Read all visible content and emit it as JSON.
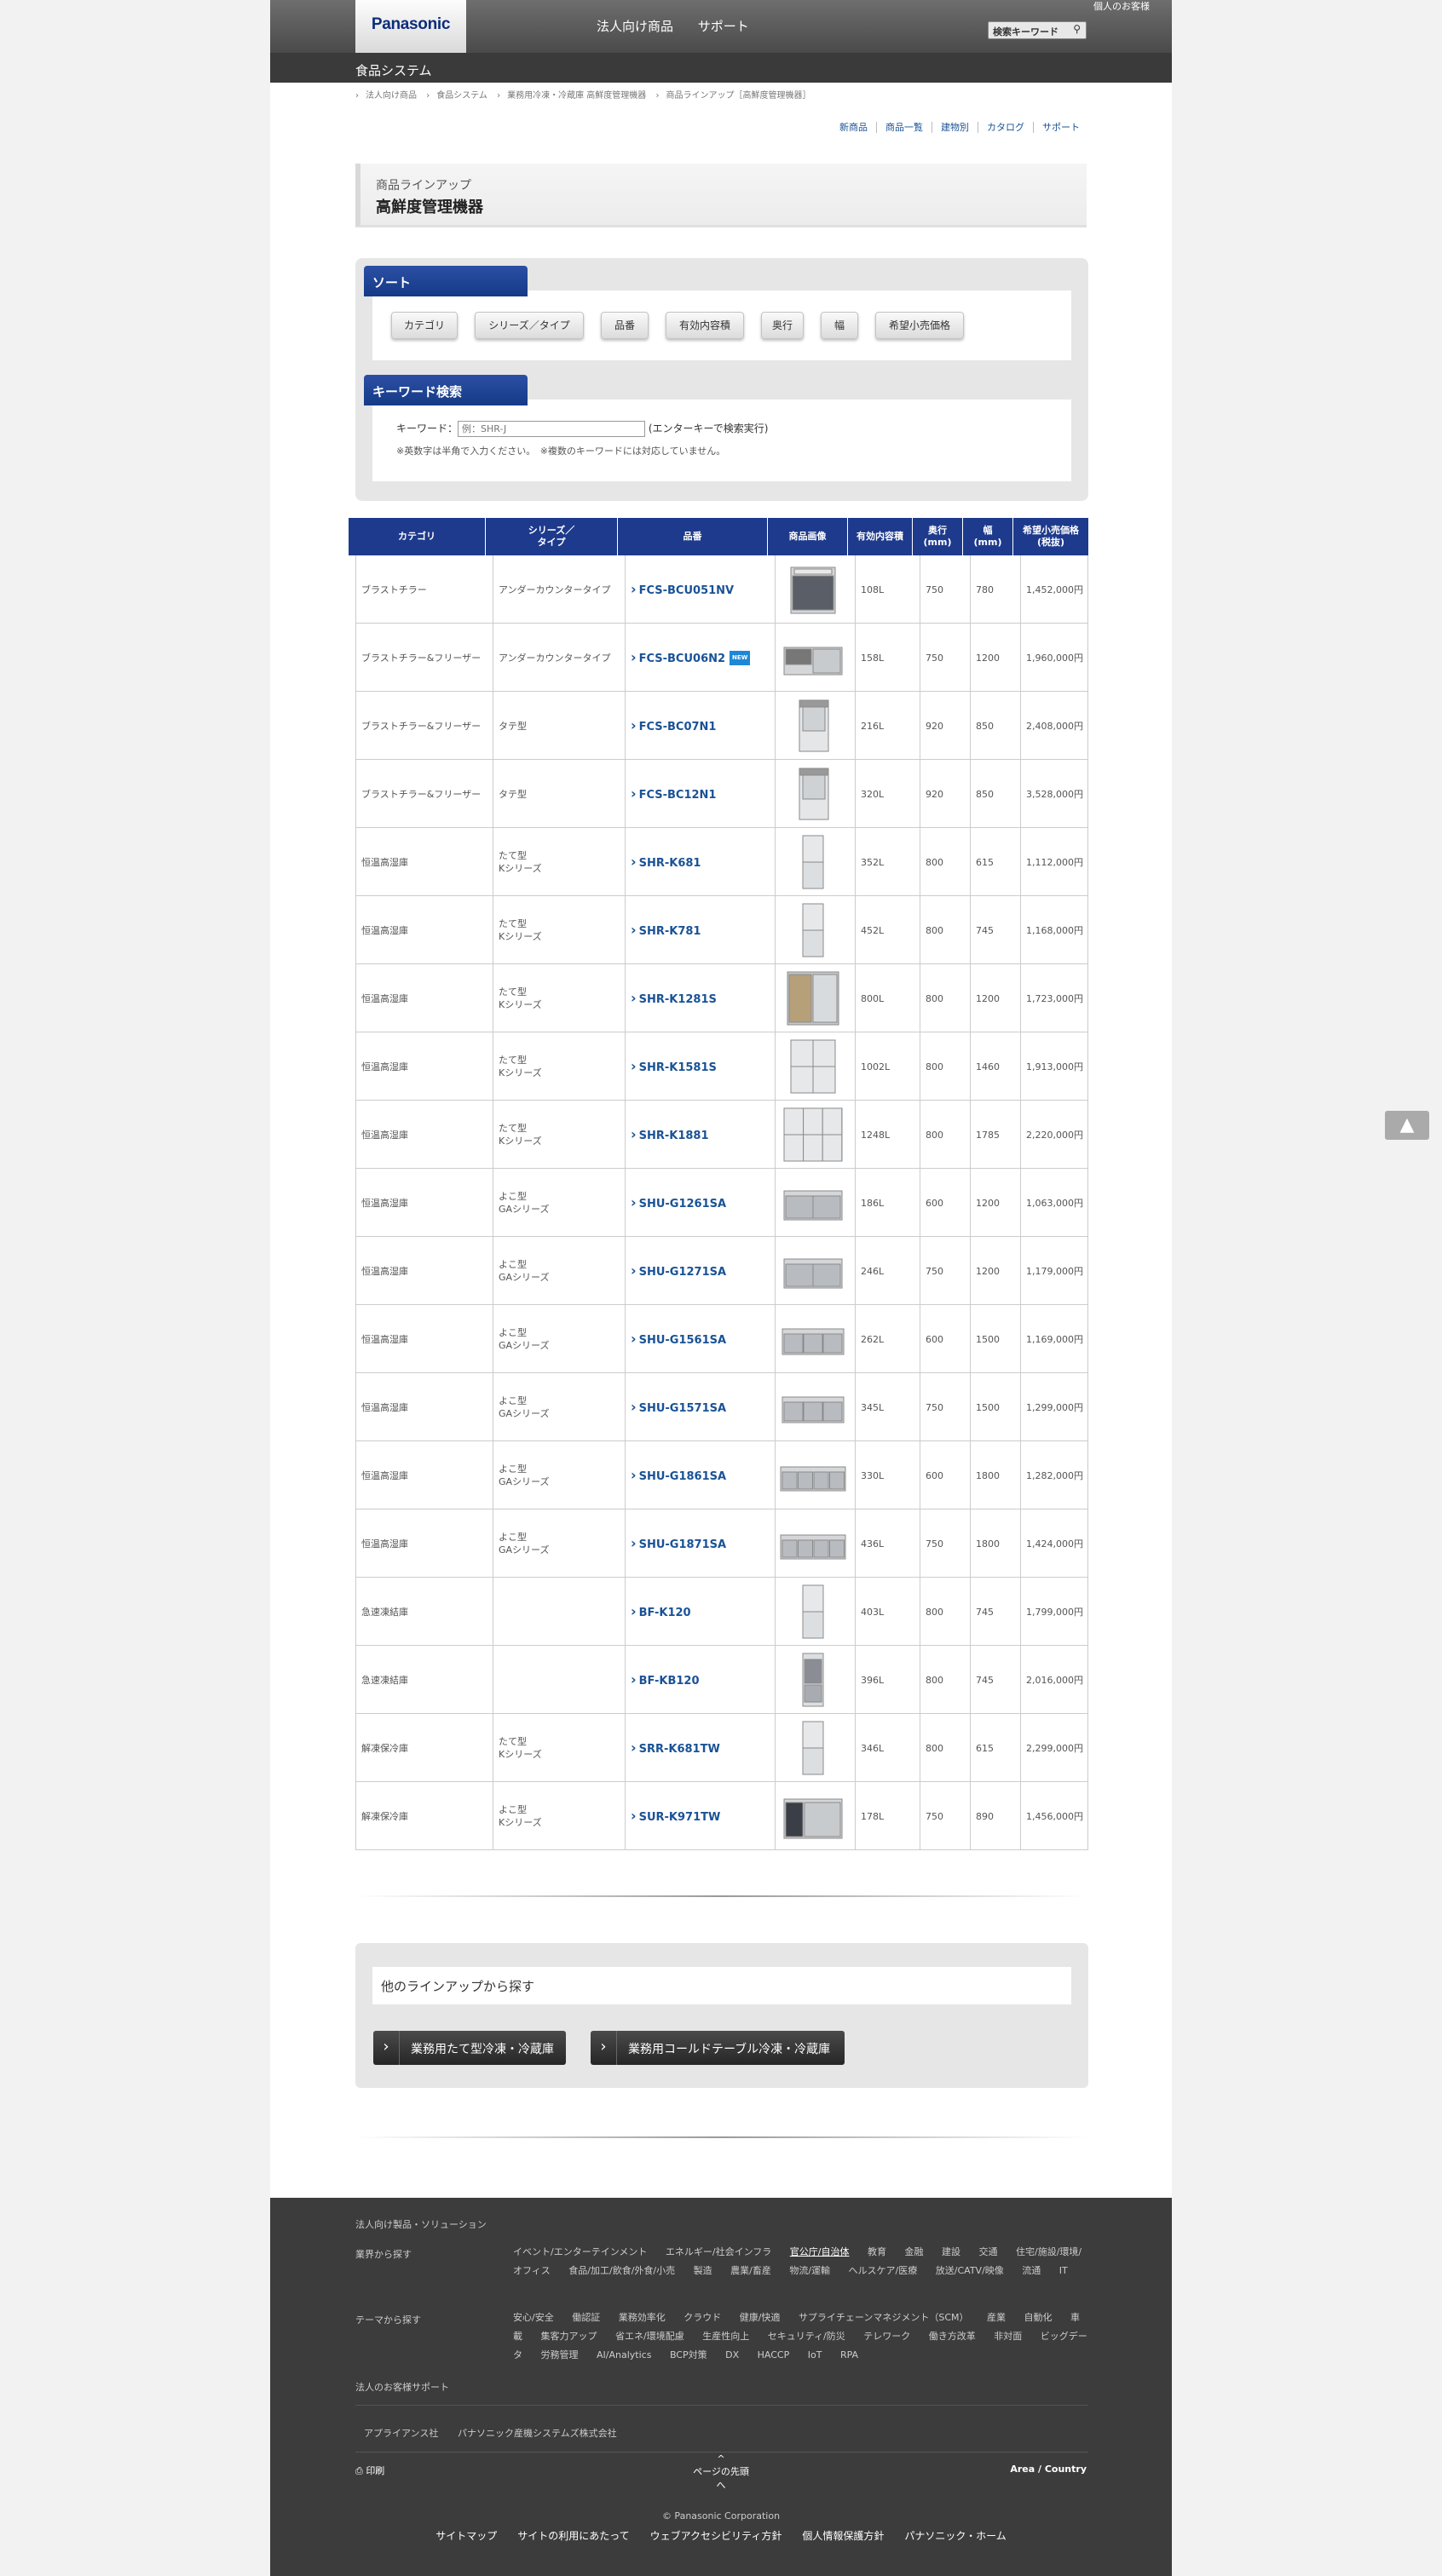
{
  "header": {
    "logo": "Panasonic",
    "nav": [
      "法人向け商品",
      "サポート"
    ],
    "personal": "個人のお客様",
    "search_label": "検索キーワード",
    "search_icon": "magnifier-icon"
  },
  "subheader": {
    "title": "食品システム"
  },
  "breadcrumb": [
    "法人向け商品",
    "食品システム",
    "業務用冷凍・冷蔵庫 高鮮度管理機器",
    "商品ラインアップ［高鮮度管理機器］"
  ],
  "utility_nav": [
    "新商品",
    "商品一覧",
    "建物別",
    "カタログ",
    "サポート"
  ],
  "page_title": {
    "sub": "商品ラインアップ",
    "main": "高鮮度管理機器"
  },
  "sort": {
    "label": "ソート",
    "buttons": [
      "カテゴリ",
      "シリーズ／タイプ",
      "品番",
      "有効内容積",
      "奥行",
      "幅",
      "希望小売価格"
    ]
  },
  "keyword": {
    "label": "キーワード検索",
    "field_label": "キーワード：",
    "placeholder": "例：SHR-J",
    "hint": "(エンターキーで検索実行)",
    "note": "※英数字は半角で入力ください。　※複数のキーワードには対応していません。"
  },
  "table": {
    "headers": [
      "カテゴリ",
      "シリーズ／\nタイプ",
      "品番",
      "商品画像",
      "有効内容積",
      "奥行\n(mm)",
      "幅\n(mm)",
      "希望小売価格\n(税抜)"
    ],
    "rows": [
      {
        "category": "ブラストチラー",
        "series": "アンダーカウンタータイプ",
        "model": "FCS-BCU051NV",
        "vol": "108L",
        "depth": "750",
        "width": "780",
        "price": "1,452,000円",
        "img": "dark-under"
      },
      {
        "category": "ブラストチラー&フリーザー",
        "series": "アンダーカウンタータイプ",
        "model": "FCS-BCU06N2",
        "new": "NEW",
        "vol": "158L",
        "depth": "750",
        "width": "1200",
        "price": "1,960,000円",
        "img": "wide"
      },
      {
        "category": "ブラストチラー&フリーザー",
        "series": "タテ型",
        "model": "FCS-BC07N1",
        "vol": "216L",
        "depth": "920",
        "width": "850",
        "price": "2,408,000円",
        "img": "tall1"
      },
      {
        "category": "ブラストチラー&フリーザー",
        "series": "タテ型",
        "model": "FCS-BC12N1",
        "vol": "320L",
        "depth": "920",
        "width": "850",
        "price": "3,528,000円",
        "img": "tall1"
      },
      {
        "category": "恒温高湿庫",
        "series": "たて型\nKシリーズ",
        "model": "SHR-K681",
        "vol": "352L",
        "depth": "800",
        "width": "615",
        "price": "1,112,000円",
        "img": "tall2"
      },
      {
        "category": "恒温高湿庫",
        "series": "たて型\nKシリーズ",
        "model": "SHR-K781",
        "vol": "452L",
        "depth": "800",
        "width": "745",
        "price": "1,168,000円",
        "img": "tall2"
      },
      {
        "category": "恒温高湿庫",
        "series": "たて型\nKシリーズ",
        "model": "SHR-K1281S",
        "vol": "800L",
        "depth": "800",
        "width": "1200",
        "price": "1,723,000円",
        "img": "open"
      },
      {
        "category": "恒温高湿庫",
        "series": "たて型\nKシリーズ",
        "model": "SHR-K1581S",
        "vol": "1002L",
        "depth": "800",
        "width": "1460",
        "price": "1,913,000円",
        "img": "quad"
      },
      {
        "category": "恒温高湿庫",
        "series": "たて型\nKシリーズ",
        "model": "SHR-K1881",
        "vol": "1248L",
        "depth": "800",
        "width": "1785",
        "price": "2,220,000円",
        "img": "six"
      },
      {
        "category": "恒温高湿庫",
        "series": "よこ型\nGAシリーズ",
        "model": "SHU-G1261SA",
        "vol": "186L",
        "depth": "600",
        "width": "1200",
        "price": "1,063,000円",
        "img": "table2"
      },
      {
        "category": "恒温高湿庫",
        "series": "よこ型\nGAシリーズ",
        "model": "SHU-G1271SA",
        "vol": "246L",
        "depth": "750",
        "width": "1200",
        "price": "1,179,000円",
        "img": "table2"
      },
      {
        "category": "恒温高湿庫",
        "series": "よこ型\nGAシリーズ",
        "model": "SHU-G1561SA",
        "vol": "262L",
        "depth": "600",
        "width": "1500",
        "price": "1,169,000円",
        "img": "table3"
      },
      {
        "category": "恒温高湿庫",
        "series": "よこ型\nGAシリーズ",
        "model": "SHU-G1571SA",
        "vol": "345L",
        "depth": "750",
        "width": "1500",
        "price": "1,299,000円",
        "img": "table3"
      },
      {
        "category": "恒温高湿庫",
        "series": "よこ型\nGAシリーズ",
        "model": "SHU-G1861SA",
        "vol": "330L",
        "depth": "600",
        "width": "1800",
        "price": "1,282,000円",
        "img": "table4"
      },
      {
        "category": "恒温高湿庫",
        "series": "よこ型\nGAシリーズ",
        "model": "SHU-G1871SA",
        "vol": "436L",
        "depth": "750",
        "width": "1800",
        "price": "1,424,000円",
        "img": "table4"
      },
      {
        "category": "急速凍結庫",
        "series": "",
        "model": "BF-K120",
        "vol": "403L",
        "depth": "800",
        "width": "745",
        "price": "1,799,000円",
        "img": "tall2"
      },
      {
        "category": "急速凍結庫",
        "series": "",
        "model": "BF-KB120",
        "vol": "396L",
        "depth": "800",
        "width": "745",
        "price": "2,016,000円",
        "img": "tall-open"
      },
      {
        "category": "解凍保冷庫",
        "series": "たて型\nKシリーズ",
        "model": "SRR-K681TW",
        "vol": "346L",
        "depth": "800",
        "width": "615",
        "price": "2,299,000円",
        "img": "tall2"
      },
      {
        "category": "解凍保冷庫",
        "series": "よこ型\nKシリーズ",
        "model": "SUR-K971TW",
        "vol": "178L",
        "depth": "750",
        "width": "890",
        "price": "1,456,000円",
        "img": "dark-table"
      }
    ]
  },
  "other": {
    "label": "他のラインアップから探す",
    "buttons": [
      "業務用たて型冷凍・冷蔵庫",
      "業務用コールドテーブル冷凍・冷蔵庫"
    ]
  },
  "footer": {
    "title": "法人向け製品・ソリューション",
    "industry_label": "業界から探す",
    "industry": [
      "イベント/エンターテインメント",
      "エネルギー/社会インフラ",
      "官公庁/自治体",
      "教育",
      "金融",
      "建設",
      "交通",
      "住宅/施設/環境/オフィス",
      "食品/加工/飲食/外食/小売",
      "製造",
      "農業/畜産",
      "物流/運輸",
      "ヘルスケア/医療",
      "放送/CATV/映像",
      "流通",
      "IT"
    ],
    "industry_selected": "官公庁/自治体",
    "theme_label": "テーマから探す",
    "themes": [
      "安心/安全",
      "働認証",
      "業務効率化",
      "クラウド",
      "健康/快適",
      "サプライチェーンマネジメント（SCM）",
      "産業",
      "自動化",
      "車載",
      "集客力アップ",
      "省エネ/環境配慮",
      "生産性向上",
      "セキュリティ/防災",
      "テレワーク",
      "働き方改革",
      "⾮対面",
      "ビッグデータ",
      "労務管理",
      "AI/Analytics",
      "BCP対策",
      "DX",
      "HACCP",
      "IoT",
      "RPA"
    ],
    "support": "法人のお客様サポート",
    "companies": [
      "アプライアンス社",
      "パナソニック産機システムズ株式会社"
    ],
    "print": "印刷",
    "pagetop": "ページの先頭へ",
    "area": "Area / Country",
    "copyright": "© Panasonic Corporation",
    "bottom": [
      "サイトマップ",
      "サイトの利用にあたって",
      "ウェブアクセシビリティ方針",
      "個人情報保護方針",
      "パナソニック・ホーム"
    ]
  },
  "scroll_top_icon": "triangle-up-icon"
}
